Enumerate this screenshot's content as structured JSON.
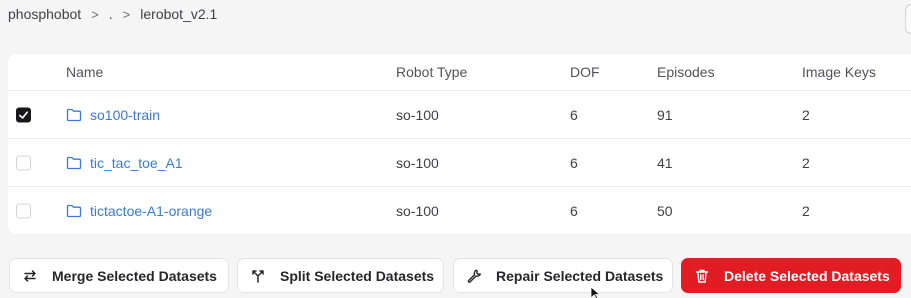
{
  "breadcrumb": {
    "items": [
      "phosphobot",
      ".",
      "lerobot_v2.1"
    ],
    "separator": ">"
  },
  "table": {
    "columns": [
      "Name",
      "Robot Type",
      "DOF",
      "Episodes",
      "Image Keys"
    ],
    "rows": [
      {
        "checked": true,
        "name": "so100-train",
        "robot_type": "so-100",
        "dof": "6",
        "episodes": "91",
        "image_keys": "2"
      },
      {
        "checked": false,
        "name": "tic_tac_toe_A1",
        "robot_type": "so-100",
        "dof": "6",
        "episodes": "41",
        "image_keys": "2"
      },
      {
        "checked": false,
        "name": "tictactoe-A1-orange",
        "robot_type": "so-100",
        "dof": "6",
        "episodes": "50",
        "image_keys": "2"
      }
    ]
  },
  "actions": {
    "merge": {
      "label": "Merge Selected Datasets",
      "icon": "arrows-swap-icon"
    },
    "split": {
      "label": "Split Selected Datasets",
      "icon": "split-icon"
    },
    "repair": {
      "label": "Repair Selected Datasets",
      "icon": "wrench-icon"
    },
    "delete": {
      "label": "Delete Selected Datasets",
      "icon": "trash-icon"
    }
  },
  "colors": {
    "link": "#3a7bd5",
    "danger": "#e11d23",
    "background": "#f5f5f6"
  }
}
